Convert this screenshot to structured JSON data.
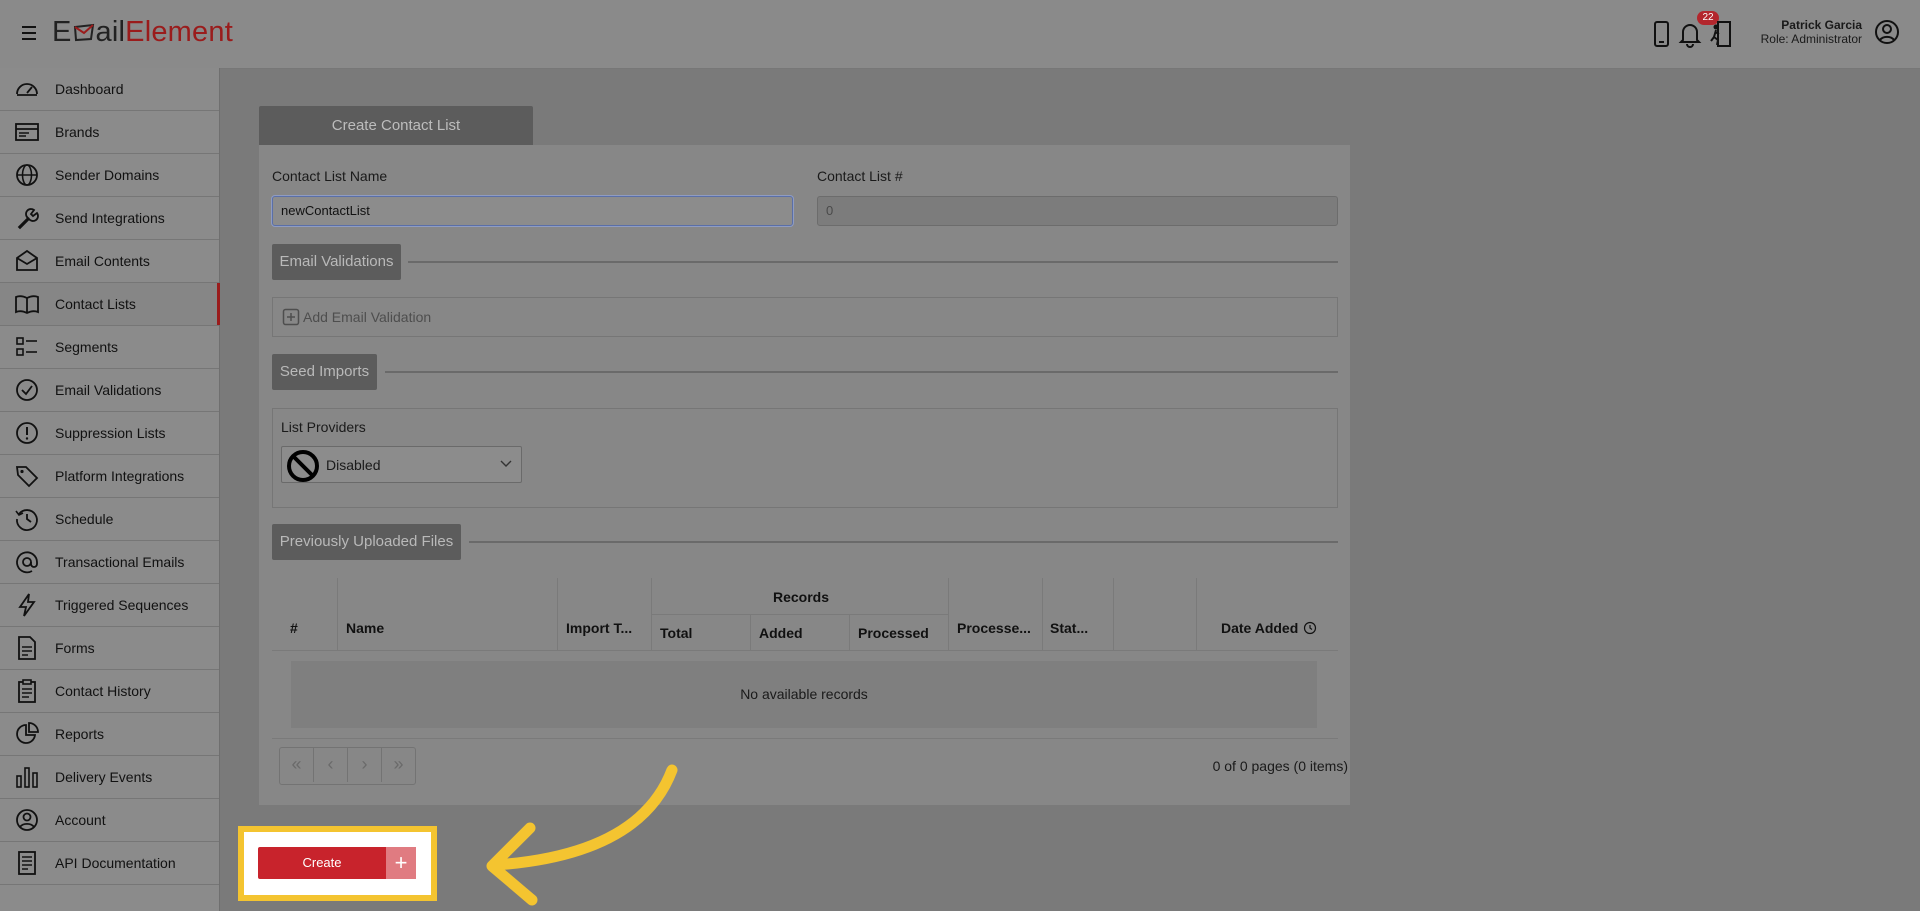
{
  "header": {
    "logo_e": "E",
    "logo_mail": "ail",
    "logo_element": "Element",
    "notification_count": "22",
    "user_name": "Patrick Garcia",
    "user_role": "Role: Administrator"
  },
  "sidebar": {
    "items": [
      {
        "label": "Dashboard",
        "icon": "dashboard-icon"
      },
      {
        "label": "Brands",
        "icon": "brands-icon"
      },
      {
        "label": "Sender Domains",
        "icon": "globe-icon"
      },
      {
        "label": "Send Integrations",
        "icon": "wrench-icon"
      },
      {
        "label": "Email Contents",
        "icon": "envelope-icon"
      },
      {
        "label": "Contact Lists",
        "icon": "book-icon",
        "active": true
      },
      {
        "label": "Segments",
        "icon": "segments-icon"
      },
      {
        "label": "Email Validations",
        "icon": "check-circle-icon"
      },
      {
        "label": "Suppression Lists",
        "icon": "exclamation-circle-icon"
      },
      {
        "label": "Platform Integrations",
        "icon": "tag-icon"
      },
      {
        "label": "Schedule",
        "icon": "history-icon"
      },
      {
        "label": "Transactional Emails",
        "icon": "at-icon"
      },
      {
        "label": "Triggered Sequences",
        "icon": "lightning-icon"
      },
      {
        "label": "Forms",
        "icon": "form-icon"
      },
      {
        "label": "Contact History",
        "icon": "clipboard-icon"
      },
      {
        "label": "Reports",
        "icon": "pie-chart-icon"
      },
      {
        "label": "Delivery Events",
        "icon": "bar-chart-icon"
      },
      {
        "label": "Account",
        "icon": "user-circle-icon"
      },
      {
        "label": "API Documentation",
        "icon": "document-icon"
      }
    ]
  },
  "form": {
    "tab_title": "Create Contact List",
    "name_label": "Contact List Name",
    "name_value": "newContactList",
    "number_label": "Contact List #",
    "number_value": "0",
    "email_validations_title": "Email Validations",
    "add_email_validation": "Add Email Validation",
    "seed_imports_title": "Seed Imports",
    "list_providers_label": "List Providers",
    "list_providers_value": "Disabled",
    "previously_uploaded_title": "Previously Uploaded Files"
  },
  "table": {
    "headers": {
      "num": "#",
      "name": "Name",
      "import_type": "Import T...",
      "records": "Records",
      "total": "Total",
      "added": "Added",
      "processed": "Processed",
      "processed_at": "Processe...",
      "status": "Stat...",
      "date_added": "Date Added"
    },
    "empty_message": "No available records"
  },
  "pager": {
    "first": "«",
    "prev": "‹",
    "next": "›",
    "last": "»",
    "info": "0 of 0 pages (0 items)"
  },
  "actions": {
    "create_label": "Create",
    "create_plus": "+"
  },
  "colors": {
    "brand_red": "#9a1c1c",
    "create_red": "#c8232c",
    "highlight_yellow": "#f4c430",
    "badge_red": "#b3262d"
  }
}
